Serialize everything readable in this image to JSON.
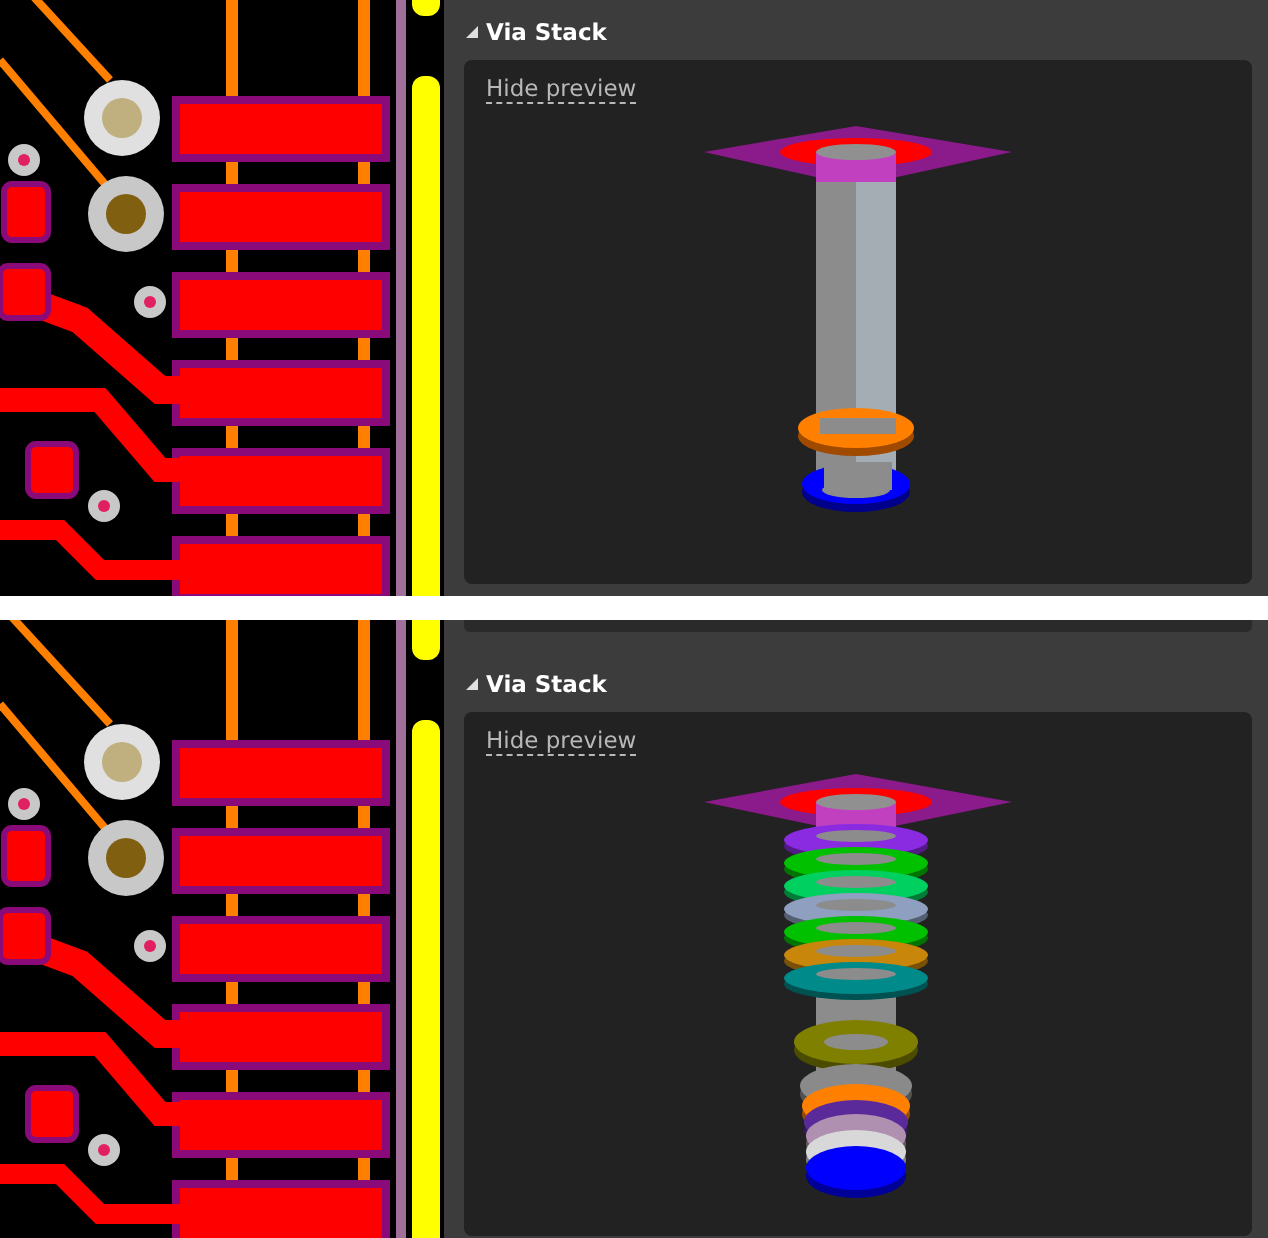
{
  "views": [
    {
      "kind": "two-layer",
      "section": {
        "title": "Via Stack",
        "expanded": true
      },
      "preview_link": "Hide preview"
    },
    {
      "kind": "multi-layer",
      "section": {
        "title": "Via Stack",
        "expanded": true
      },
      "preview_link": "Hide preview"
    }
  ]
}
